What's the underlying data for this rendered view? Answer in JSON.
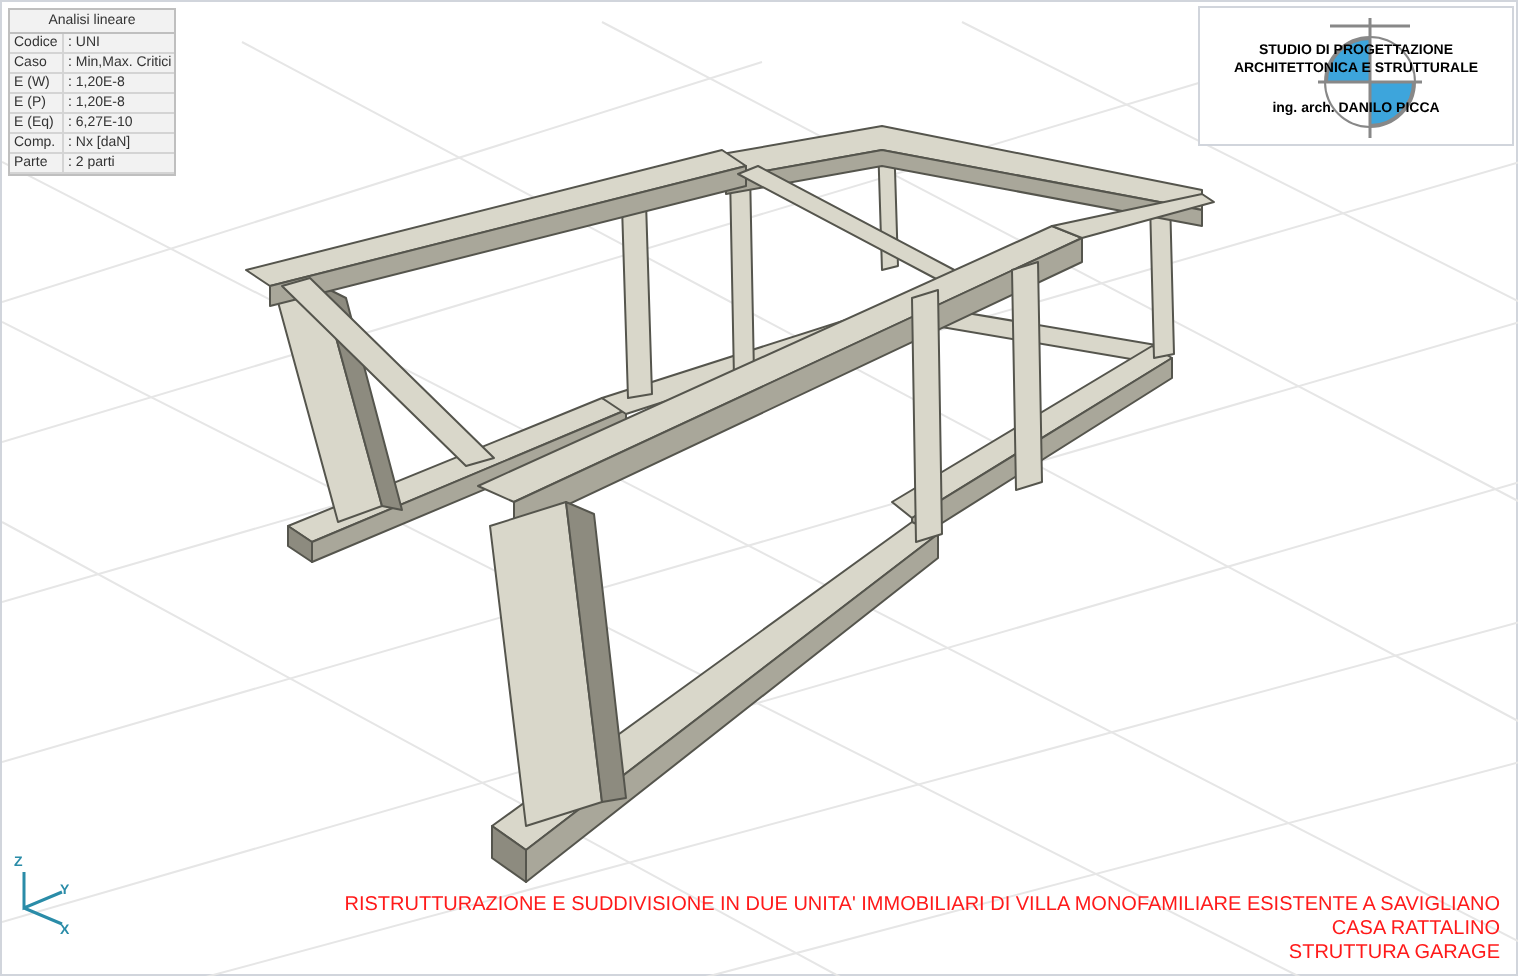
{
  "info_panel": {
    "title": "Analisi lineare",
    "rows": [
      {
        "label": "Codice",
        "value": ": UNI"
      },
      {
        "label": "Caso",
        "value": ": Min,Max. Critici"
      },
      {
        "label": "E (W)",
        "value": ": 1,20E-8"
      },
      {
        "label": "E (P)",
        "value": ": 1,20E-8"
      },
      {
        "label": "E (Eq)",
        "value": ": 6,27E-10"
      },
      {
        "label": "Comp.",
        "value": ": Nx [daN]"
      },
      {
        "label": "Parte",
        "value": ": 2 parti"
      }
    ]
  },
  "logo": {
    "lines": [
      "STUDIO DI PROGETTAZIONE",
      "ARCHITETTONICA E STRUTTURALE"
    ],
    "author": "ing. arch. DANILO PICCA"
  },
  "axes": {
    "z": "Z",
    "y": "Y",
    "x": "X"
  },
  "title_block": [
    "RISTRUTTURAZIONE E SUDDIVISIONE IN DUE UNITA' IMMOBILIARI DI VILLA MONOFAMILIARE ESISTENTE A SAVIGLIANO",
    "CASA RATTALINO",
    "STRUTTURA GARAGE"
  ]
}
